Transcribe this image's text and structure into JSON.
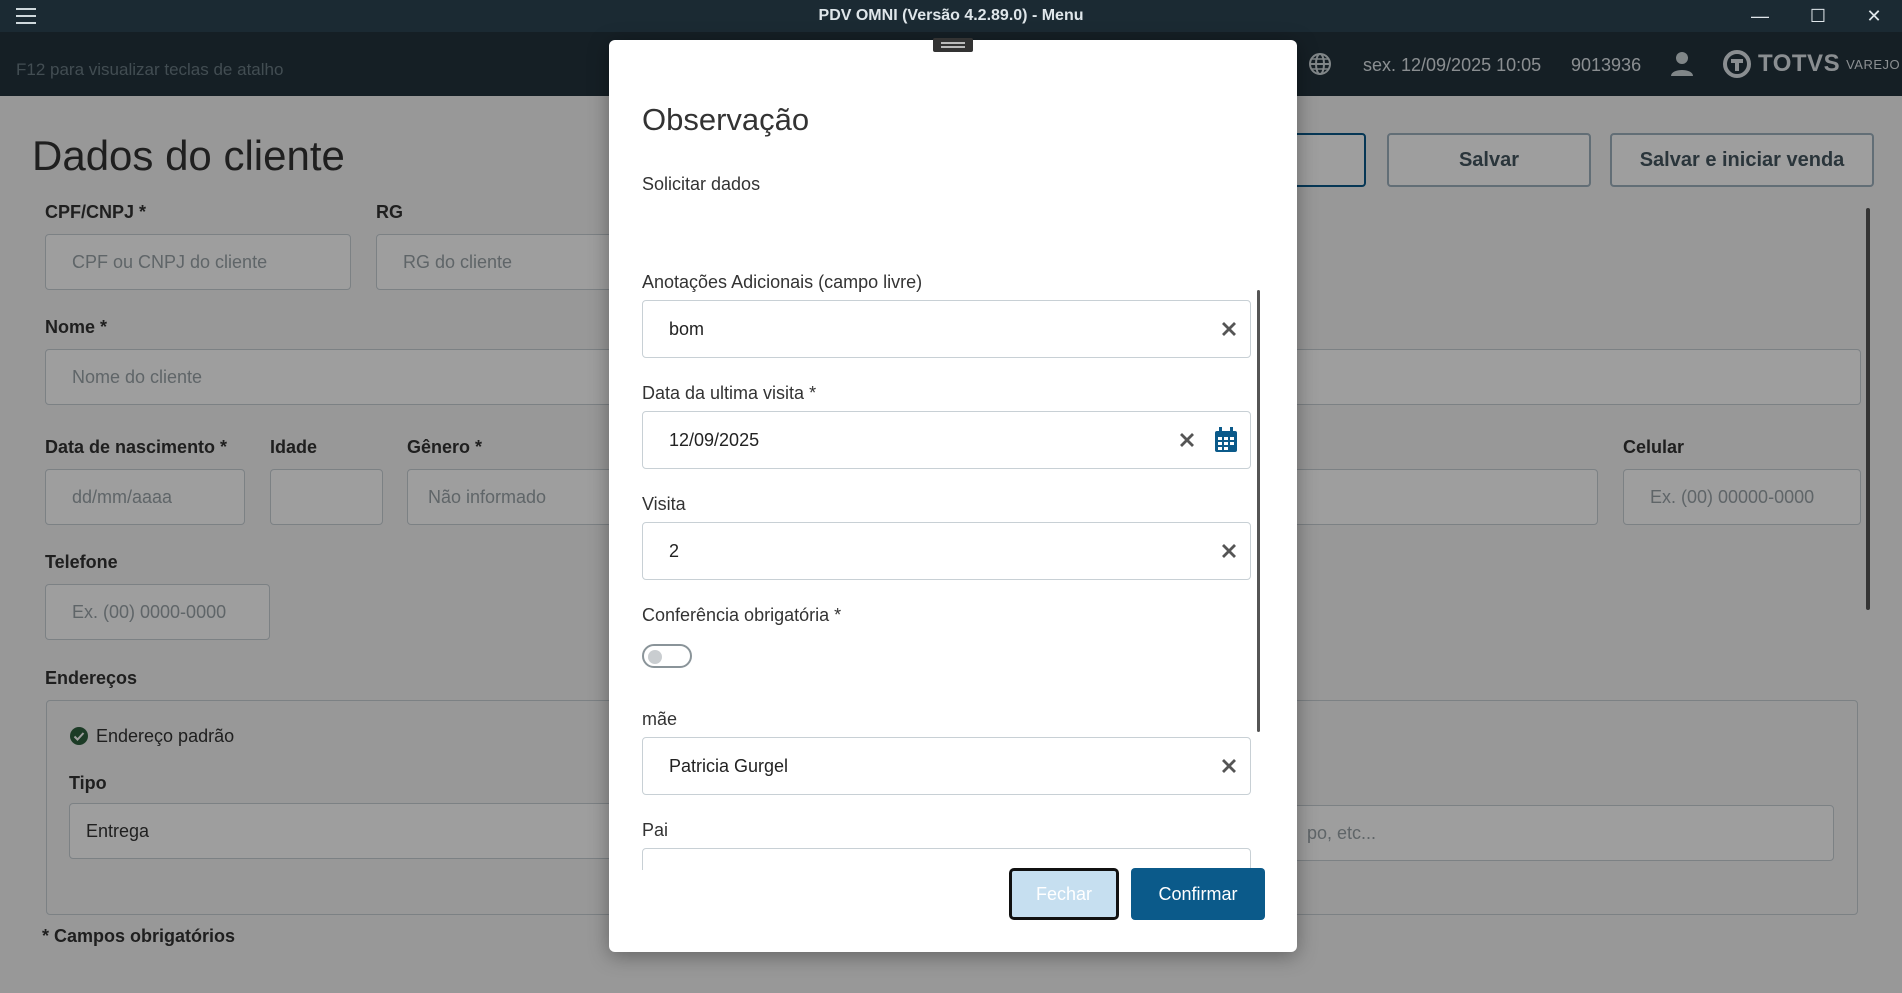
{
  "window": {
    "title": "PDV OMNI (Versão 4.2.89.0) - Menu",
    "minimize": "—",
    "maximize": "☐",
    "close": "✕"
  },
  "header": {
    "shortcut_hint": "F12 para visualizar teclas de atalho",
    "datetime": "sex. 12/09/2025 10:05",
    "user_id": "9013936",
    "logo_text": "TOTVS",
    "logo_sub": "VAREJO"
  },
  "page": {
    "title": "Dados do cliente",
    "buttons": {
      "save": "Salvar",
      "save_and_start": "Salvar e iniciar venda"
    },
    "fields": {
      "cpf_label": "CPF/CNPJ  *",
      "cpf_placeholder": "CPF ou CNPJ do cliente",
      "rg_label": "RG",
      "rg_placeholder": "RG do cliente",
      "nome_label": "Nome *",
      "nome_placeholder": "Nome do cliente",
      "nascimento_label": "Data de nascimento *",
      "nascimento_placeholder": "dd/mm/aaaa",
      "idade_label": "Idade",
      "genero_label": "Gênero *",
      "genero_value": "Não informado",
      "celular_label": "Celular",
      "celular_placeholder": "Ex. (00) 00000-0000",
      "telefone_label": "Telefone",
      "telefone_placeholder": "Ex. (00) 0000-0000",
      "enderecos_label": "Endereços",
      "endereco_padrao": "Endereço padrão",
      "tipo_label": "Tipo",
      "tipo_value": "Entrega",
      "complemento_partial": "po, etc..."
    },
    "required_note": "* Campos obrigatórios"
  },
  "modal": {
    "title": "Observação",
    "subtitle": "Solicitar dados",
    "fields": [
      {
        "label": "Anotações Adicionais (campo livre)",
        "value": "bom"
      },
      {
        "label": "Data da ultima visita *",
        "value": "12/09/2025"
      },
      {
        "label": "Visita",
        "value": "2"
      },
      {
        "label": "Conferência obrigatória *",
        "toggle_on": false
      },
      {
        "label": "mãe",
        "value": "Patricia Gurgel"
      },
      {
        "label": "Pai",
        "value": ""
      }
    ],
    "buttons": {
      "close": "Fechar",
      "confirm": "Confirmar"
    }
  },
  "colors": {
    "titlebar": "#1b2a33",
    "header": "#22323c",
    "primary": "#0b5a8a",
    "calendar_icon": "#0b5a8a"
  }
}
